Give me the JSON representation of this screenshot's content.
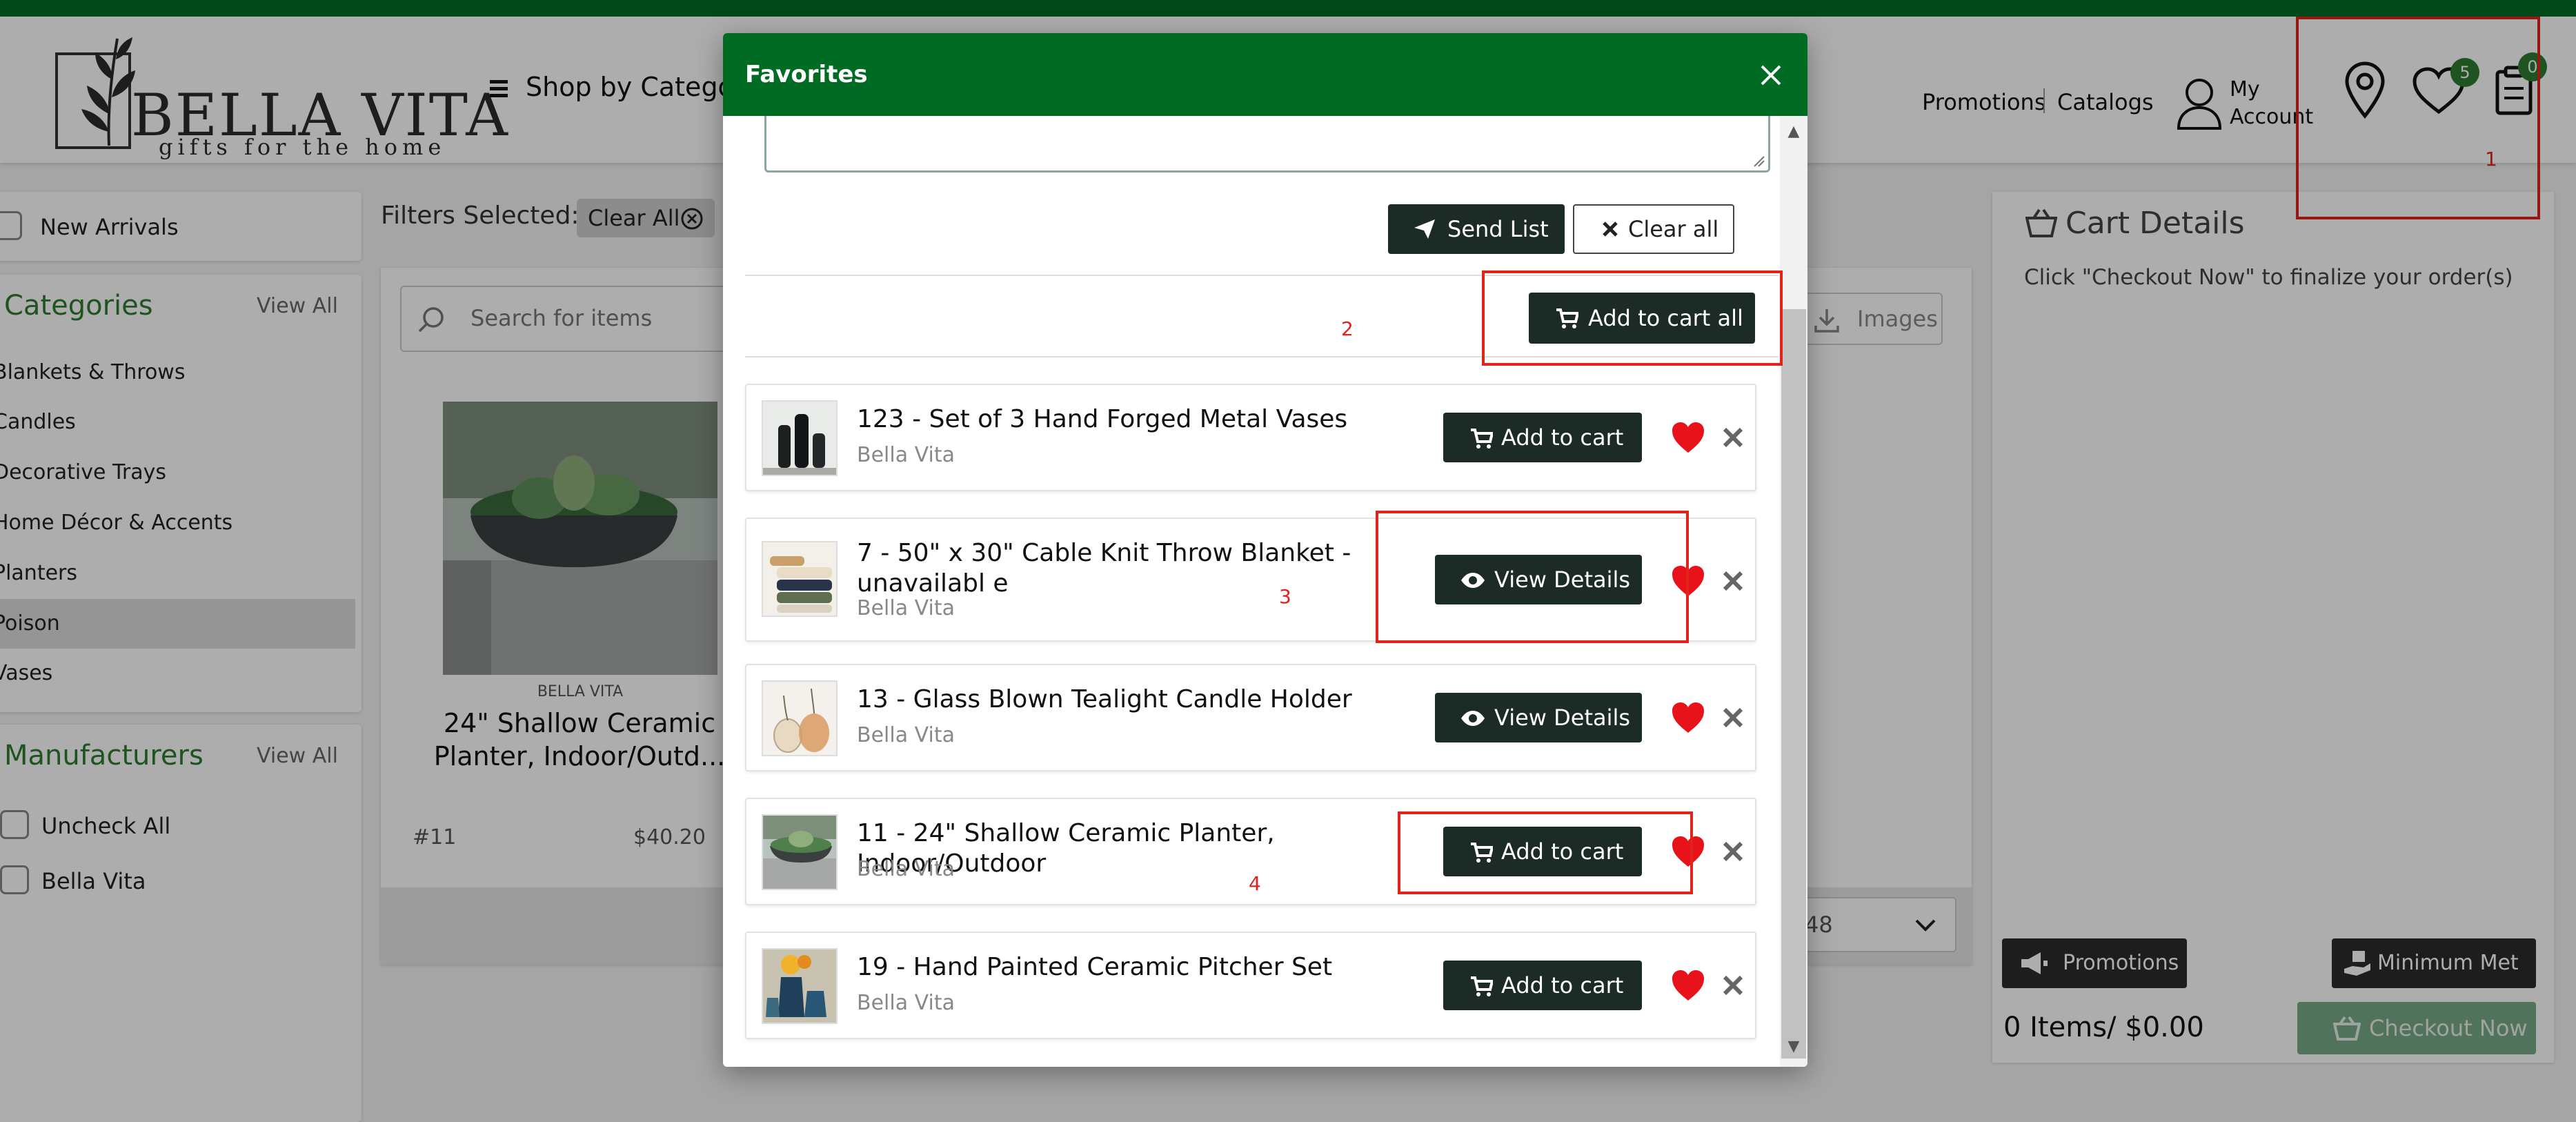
{
  "header": {
    "logo_name": "BELLA VITA",
    "logo_tagline": "gifts for the home",
    "shop_by_category": "Shop by Categor",
    "nav_promotions": "Promotions",
    "nav_catalogs": "Catalogs",
    "my_account_line1": "My",
    "my_account_line2": "Account",
    "favorites_count": "5",
    "cart_count": "0"
  },
  "sidebar": {
    "new_arrivals": "New Arrivals",
    "categories_title": "Categories",
    "categories_view_all": "View All",
    "categories": [
      {
        "label": "Blankets & Throws",
        "active": false
      },
      {
        "label": "Candles",
        "active": false
      },
      {
        "label": "Decorative Trays",
        "active": false
      },
      {
        "label": "Home Décor & Accents",
        "active": false
      },
      {
        "label": "Planters",
        "active": false
      },
      {
        "label": "Poison",
        "active": true
      },
      {
        "label": "Vases",
        "active": false
      }
    ],
    "manufacturers_title": "Manufacturers",
    "manufacturers_view_all": "View All",
    "uncheck_all": "Uncheck All",
    "manufacturer_bella_vita": "Bella Vita"
  },
  "main": {
    "filters_selected": "Filters Selected:",
    "clear_all_chip": "Clear All",
    "search_placeholder": "Search for items",
    "images_button": "Images",
    "product": {
      "brand": "BELLA VITA",
      "name": "24\" Shallow Ceramic Planter, Indoor/Outd...",
      "sku": "#11",
      "price": "$40.20"
    },
    "per_page": "48"
  },
  "cart": {
    "title": "Cart Details",
    "subtitle": "Click \"Checkout Now\" to finalize your order(s)",
    "promotions_button": "Promotions",
    "minimum_met_button": "Minimum Met",
    "total": "0 Items/ $0.00",
    "checkout_button": "Checkout Now"
  },
  "modal": {
    "title": "Favorites",
    "send_list": "Send List",
    "clear_all": "Clear all",
    "add_to_cart_all": "Add to cart all",
    "items": [
      {
        "title": "123 - Set of 3 Hand Forged Metal Vases",
        "brand": "Bella Vita",
        "button": "Add to cart",
        "button_icon": "cart-icon"
      },
      {
        "title": "7 - 50\" x 30\" Cable Knit Throw Blanket - unavailabl e",
        "brand": "Bella Vita",
        "button": "View Details",
        "button_icon": "eye-icon"
      },
      {
        "title": "13 - Glass Blown Tealight Candle Holder",
        "brand": "Bella Vita",
        "button": "View Details",
        "button_icon": "eye-icon"
      },
      {
        "title": "11 - 24\" Shallow Ceramic Planter, Indoor/Outdoor",
        "brand": "Bella Vita",
        "button": "Add to cart",
        "button_icon": "cart-icon"
      },
      {
        "title": "19 - Hand Painted Ceramic Pitcher Set",
        "brand": "Bella Vita",
        "button": "Add to cart",
        "button_icon": "cart-icon"
      }
    ]
  },
  "annotations": [
    "1",
    "2",
    "3",
    "4"
  ],
  "colors": {
    "brand_green": "#006b23",
    "button_dark": "#1c2b26",
    "heart_red": "#e8121b",
    "annotation_red": "#e0231b"
  }
}
